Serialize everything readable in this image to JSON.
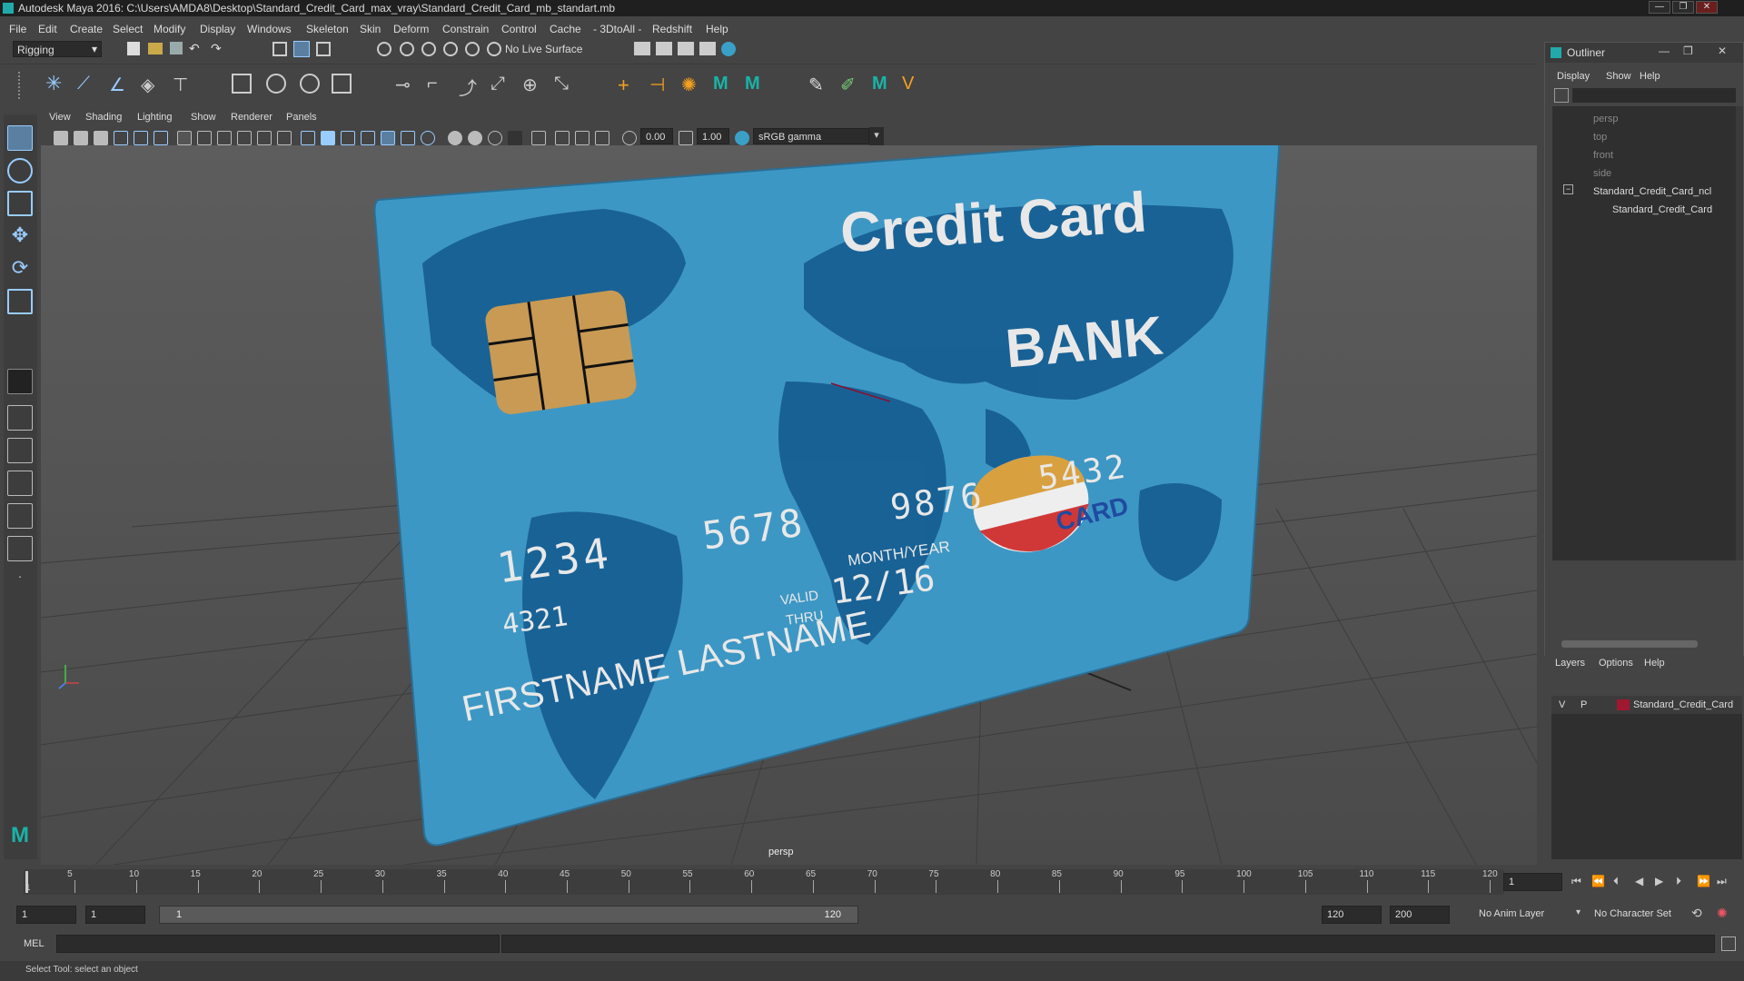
{
  "titlebar": {
    "title": "Autodesk Maya 2016: C:\\Users\\AMDA8\\Desktop\\Standard_Credit_Card_max_vray\\Standard_Credit_Card_mb_standart.mb",
    "min": "—",
    "max": "❐",
    "close": "✕"
  },
  "menubar": [
    "File",
    "Edit",
    "Create",
    "Select",
    "Modify",
    "Display",
    "Windows",
    "Skeleton",
    "Skin",
    "Deform",
    "Constrain",
    "Control",
    "Cache",
    "- 3DtoAll -",
    "Redshift",
    "Help"
  ],
  "shelfbar": {
    "mode": "Rigging",
    "live_surface": "No Live Surface"
  },
  "viewport": {
    "menu": [
      "View",
      "Shading",
      "Lighting",
      "Show",
      "Renderer",
      "Panels"
    ],
    "field_a": "0.00",
    "field_b": "1.00",
    "color_space": "sRGB gamma",
    "camera_label": "persp"
  },
  "card": {
    "title": "Credit Card",
    "bank": "BANK",
    "num1": "1234",
    "num2": "5678",
    "num3": "9876",
    "num4": "5432",
    "small_num": "4321",
    "valid1": "VALID",
    "valid2": "THRU",
    "monthyear": "MONTH/YEAR",
    "expiry": "12/16",
    "name": "FIRSTNAME LASTNAME",
    "logo": "CARD"
  },
  "outliner": {
    "title": "Outliner",
    "menu": [
      "Display",
      "Show",
      "Help"
    ],
    "items": [
      "persp",
      "top",
      "front",
      "side",
      "Standard_Credit_Card_ncl",
      "Standard_Credit_Card"
    ]
  },
  "layers": {
    "menu": [
      "Layers",
      "Options",
      "Help"
    ],
    "v": "V",
    "p": "P",
    "name": "Standard_Credit_Card",
    "color": "#a01830"
  },
  "timeline": {
    "ticks": [
      "5",
      "10",
      "15",
      "20",
      "25",
      "30",
      "35",
      "40",
      "45",
      "50",
      "55",
      "60",
      "65",
      "70",
      "75",
      "80",
      "85",
      "90",
      "95",
      "100",
      "105",
      "110",
      "115",
      "120"
    ],
    "start": "1",
    "current": "1"
  },
  "range": {
    "start": "1",
    "inner_start": "1",
    "slider_start": "1",
    "slider_end": "120",
    "end": "120",
    "max_end": "200",
    "anim_layer": "No Anim Layer",
    "char_set": "No Character Set"
  },
  "cmd": {
    "label": "MEL"
  },
  "help": {
    "text": "Select Tool: select an object"
  }
}
